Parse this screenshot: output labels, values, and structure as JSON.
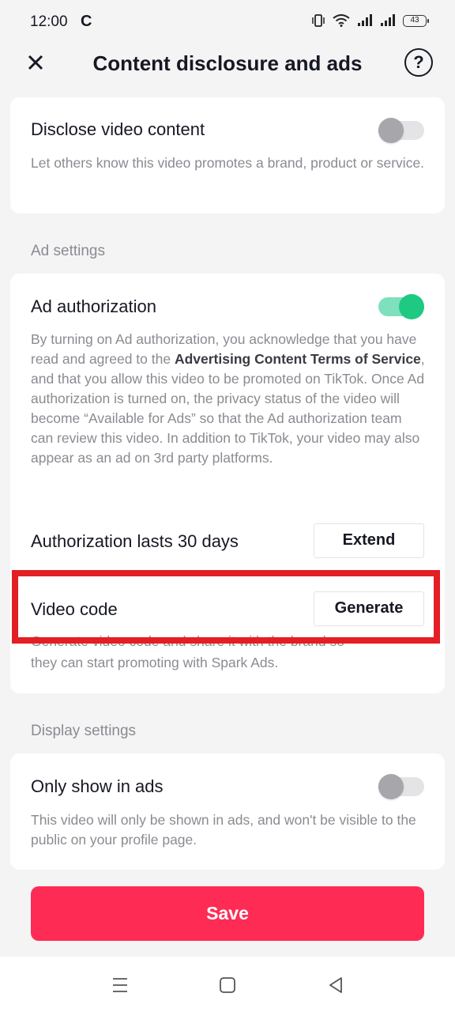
{
  "status_bar": {
    "time": "12:00",
    "carrier_icon": "C",
    "battery": "43",
    "icons": [
      "vibrate-icon",
      "wifi-icon",
      "signal-icon",
      "signal-icon",
      "battery-icon"
    ]
  },
  "header": {
    "title": "Content disclosure and ads",
    "close_icon": "close-icon",
    "help_icon": "help-icon"
  },
  "disclose": {
    "title": "Disclose video content",
    "description": "Let others know this video promotes a brand, product or service.",
    "toggle_on": false
  },
  "ad_settings": {
    "section_label": "Ad settings",
    "ad_authorization": {
      "title": "Ad authorization",
      "toggle_on": true,
      "description_part1": "By turning on Ad authorization, you acknowledge that you have read and agreed to the ",
      "description_link": "Advertising Content Terms of Service",
      "description_part2": ", and that you allow this video to be promoted on TikTok. Once Ad authorization is turned on, the privacy status of the video will become “Available for Ads” so that the Ad authorization team can review this video. In addition to TikTok, your video may also appear as an ad on 3rd party platforms."
    },
    "authorization_duration": {
      "label": "Authorization lasts 30 days",
      "button": "Extend"
    },
    "video_code": {
      "label": "Video code",
      "button": "Generate",
      "description_line1": "Generate video code and share it with the brand so",
      "description_line2": "they can start promoting with Spark Ads."
    }
  },
  "display_settings": {
    "section_label": "Display settings",
    "only_show_in_ads": {
      "title": "Only show in ads",
      "description": "This video will only be shown in ads, and won't be visible to the public on your profile page.",
      "toggle_on": false
    }
  },
  "save_button": "Save",
  "colors": {
    "accent": "#fe2c55",
    "toggle_on": "#1ec981",
    "highlight": "#e31e24"
  }
}
